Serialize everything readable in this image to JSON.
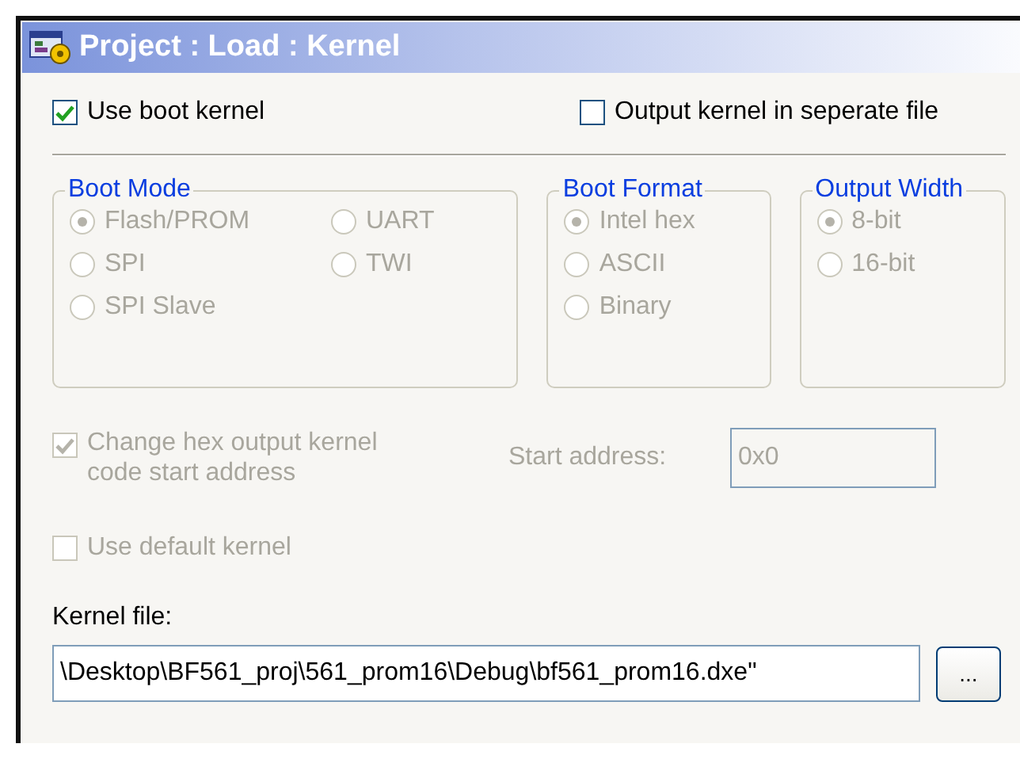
{
  "window": {
    "title": "Project : Load : Kernel"
  },
  "top_options": [
    {
      "label": "Use boot kernel",
      "checked": true,
      "disabled": false
    },
    {
      "label": "Output kernel in seperate file",
      "checked": false,
      "disabled": false
    }
  ],
  "groups": [
    {
      "title": "Boot Mode",
      "kind": "grid",
      "options": [
        {
          "label": "Flash/PROM",
          "selected": true,
          "disabled": true
        },
        {
          "label": "UART",
          "selected": false,
          "disabled": true
        },
        {
          "label": "SPI",
          "selected": false,
          "disabled": true
        },
        {
          "label": "TWI",
          "selected": false,
          "disabled": true
        },
        {
          "label": "SPI Slave",
          "selected": false,
          "disabled": true
        }
      ]
    },
    {
      "title": "Boot Format",
      "kind": "list",
      "options": [
        {
          "label": "Intel hex",
          "selected": true,
          "disabled": true
        },
        {
          "label": "ASCII",
          "selected": false,
          "disabled": true
        },
        {
          "label": "Binary",
          "selected": false,
          "disabled": true
        }
      ]
    },
    {
      "title": "Output Width",
      "kind": "list",
      "options": [
        {
          "label": "8-bit",
          "selected": true,
          "disabled": true
        },
        {
          "label": "16-bit",
          "selected": false,
          "disabled": true
        }
      ]
    }
  ],
  "hex_option": {
    "label": "Change hex output kernel code start address",
    "checked": true,
    "disabled": true
  },
  "start_address": {
    "label": "Start address:",
    "value": "0x0",
    "disabled": true
  },
  "default_kernel": {
    "label": "Use default kernel",
    "checked": false,
    "disabled": true
  },
  "kernel_file": {
    "label": "Kernel file:",
    "value": "\\Desktop\\BF561_proj\\561_prom16\\Debug\\bf561_prom16.dxe\"",
    "browse": "..."
  }
}
